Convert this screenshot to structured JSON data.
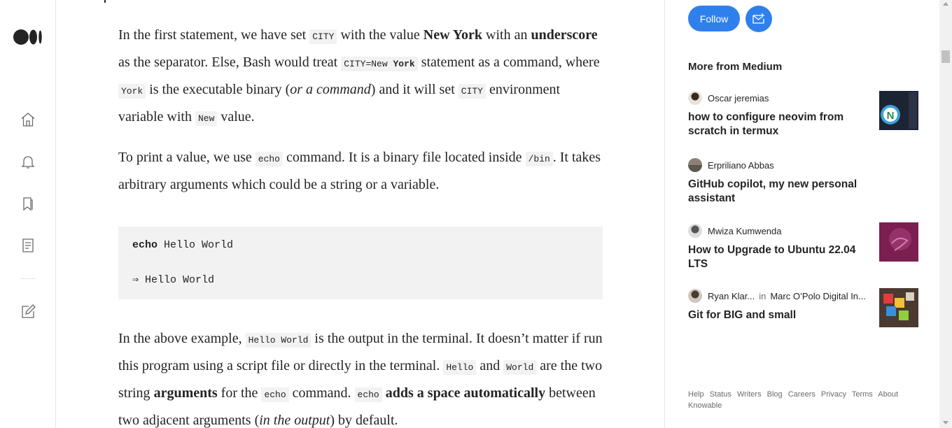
{
  "nav": {
    "logo": "medium-logo",
    "icons": [
      "home-icon",
      "notifications-icon",
      "lists-icon",
      "stories-icon",
      "write-icon"
    ]
  },
  "article": {
    "p1": {
      "t1": "In the first statement, we have set ",
      "c1": "CITY",
      "t2": " with the value ",
      "b1": "New York",
      "t3": " with an ",
      "b2": "underscore",
      "t4": " as the separator. Else, Bash would treat ",
      "c2a": "CITY=New ",
      "c2b": "York",
      "t5": " statement as a command, where ",
      "c3": "York",
      "t6": " is the executable binary (",
      "i1": "or a command",
      "t7": ") and it will set ",
      "c4": "CITY",
      "t8": " environment variable with ",
      "c5": "New",
      "t9": " value."
    },
    "p2": {
      "t1": "To print a value, we use ",
      "c1": "echo",
      "t2": " command. It is a binary file located inside ",
      "c2": "/bin",
      "t3": ". It takes arbitrary arguments which could be a string or a variable."
    },
    "code": {
      "line1_kw": "echo",
      "line1_rest": " Hello World",
      "line2": "⇒ Hello World"
    },
    "p3": {
      "t1": "In the above example, ",
      "c1": "Hello World",
      "t2": " is the output in the terminal. It doesn’t matter if run this program using a script file or directly in the terminal. ",
      "c2": "Hello",
      "t3": " and ",
      "c3": "World",
      "t4": " are the two string ",
      "b1": "arguments",
      "t5": " for the ",
      "c4": "echo",
      "t6": " command. ",
      "c5": "echo",
      "t7": " ",
      "b2": "adds a space automatically",
      "t8": " between two adjacent arguments (",
      "i1": "in the output",
      "t9": ") by default."
    }
  },
  "sidebar": {
    "follow_label": "Follow",
    "more_title": "More from Medium",
    "stories": [
      {
        "author": "Oscar jeremias",
        "publication": "",
        "in_word": "",
        "title": "how to configure neovim from scratch in termux"
      },
      {
        "author": "Erpriliano Abbas",
        "publication": "",
        "in_word": "",
        "title": "GitHub copilot, my new personal assistant"
      },
      {
        "author": "Mwiza Kumwenda",
        "publication": "",
        "in_word": "",
        "title": "How to Upgrade to Ubuntu 22.04 LTS"
      },
      {
        "author": "Ryan Klar...",
        "publication": "Marc O’Polo Digital In...",
        "in_word": "in",
        "title": "Git for BIG and small"
      }
    ],
    "footer": [
      "Help",
      "Status",
      "Writers",
      "Blog",
      "Careers",
      "Privacy",
      "Terms",
      "About",
      "Knowable"
    ]
  },
  "colors": {
    "accent": "#2f80ed",
    "text": "#242424",
    "code_bg": "#f2f2f2",
    "muted": "#6b6b6b"
  }
}
